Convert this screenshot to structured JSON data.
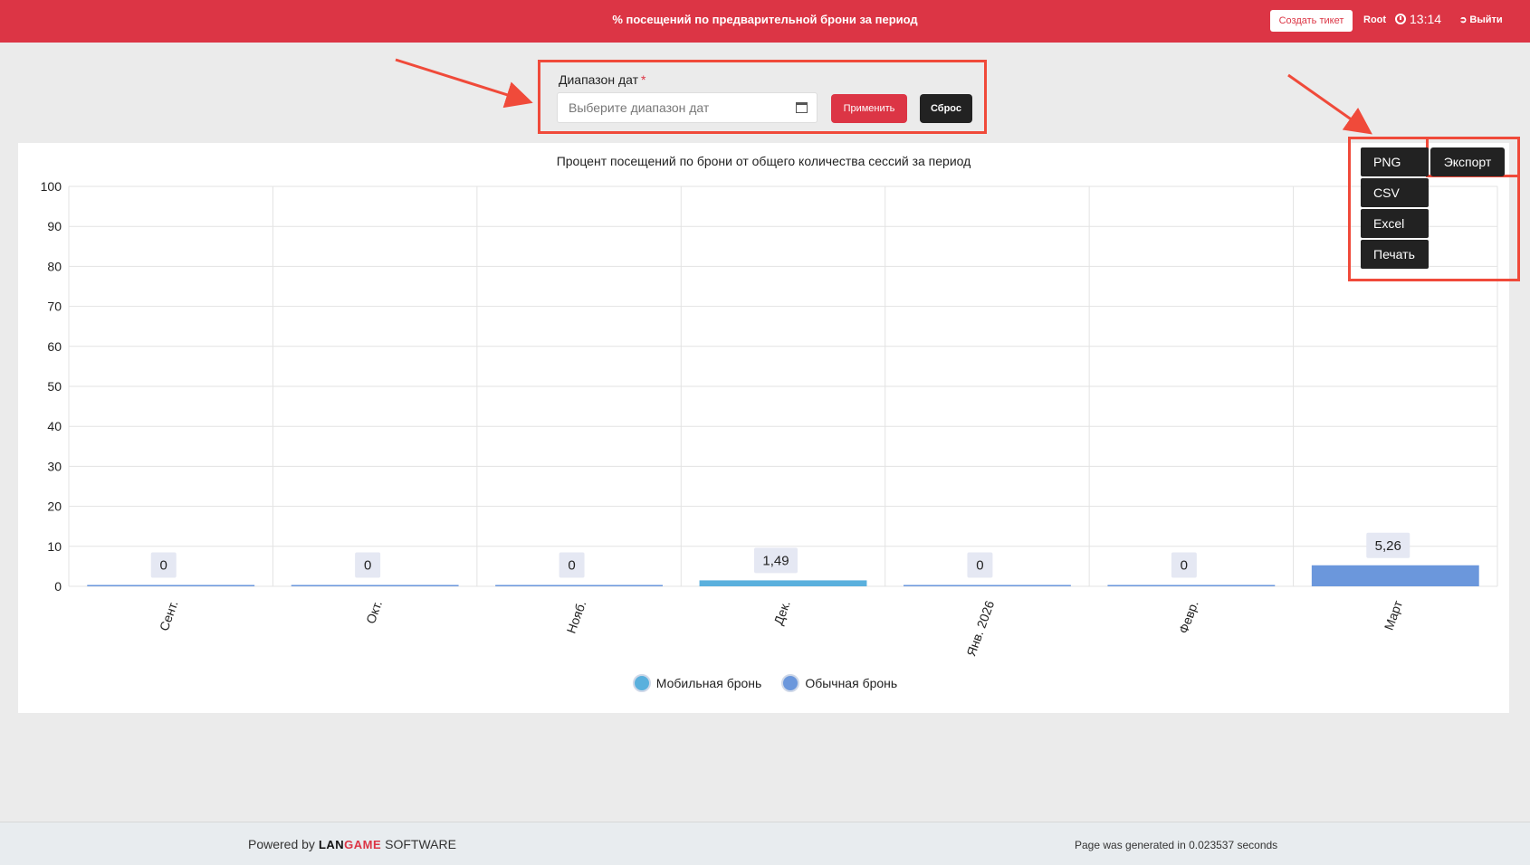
{
  "header": {
    "title": "% посещений по предварительной брони за период",
    "create_ticket": "Создать тикет",
    "user": "Root",
    "time": "13:14",
    "logout": "Выйти"
  },
  "filter": {
    "label": "Диапазон дат",
    "required_mark": "*",
    "placeholder": "Выберите диапазон дат",
    "apply": "Применить",
    "reset": "Сброс"
  },
  "export_menu": {
    "button": "Экспорт",
    "items": [
      "PNG",
      "CSV",
      "Excel",
      "Печать"
    ]
  },
  "legend": {
    "mobile": "Мобильная бронь",
    "regular": "Обычная бронь"
  },
  "colors": {
    "header_bg": "#dc3545",
    "mobile": "#5ab0dd",
    "regular": "#6b97dc",
    "annotation": "#f04a3a"
  },
  "chart_data": {
    "type": "bar",
    "title": "Процент посещений по брони от общего количества сессий за период",
    "categories": [
      "Сент.",
      "Окт.",
      "Нояб.",
      "Дек.",
      "Янв. 2026",
      "Февр.",
      "Март"
    ],
    "series": [
      {
        "name": "Мобильная бронь",
        "values": [
          0,
          0,
          0,
          1.49,
          0,
          0,
          0
        ]
      },
      {
        "name": "Обычная бронь",
        "values": [
          0,
          0,
          0,
          0,
          0,
          0,
          5.26
        ]
      }
    ],
    "data_labels": [
      "0",
      "0",
      "0",
      "1,49",
      "0",
      "0",
      "5,26"
    ],
    "y_ticks": [
      "0",
      "10",
      "20",
      "30",
      "40",
      "50",
      "60",
      "70",
      "80",
      "90",
      "100"
    ],
    "ylim": [
      0,
      100
    ],
    "grid": true,
    "legend_position": "bottom"
  },
  "footer": {
    "powered_by": "Powered by",
    "brand_a": "LAN",
    "brand_b": "GAME",
    "brand_c": "SOFTWARE",
    "generated": "Page was generated in 0.023537 seconds"
  }
}
